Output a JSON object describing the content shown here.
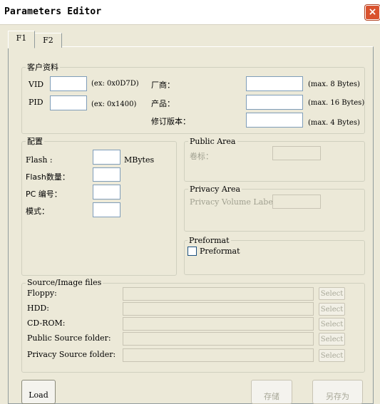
{
  "window": {
    "title": "Parameters Editor",
    "close_glyph": "×"
  },
  "tabs": [
    {
      "label": "F1"
    },
    {
      "label": "F2"
    }
  ],
  "customer": {
    "title": "客户资料",
    "vid_label": "VID",
    "vid_value": "",
    "vid_hint": "(ex: 0x0D7D)",
    "pid_label": "PID",
    "pid_value": "",
    "pid_hint": "(ex: 0x1400)",
    "vendor_label": "厂商：",
    "vendor_value": "",
    "vendor_hint": "(max. 8 Bytes)",
    "product_label": "产品：",
    "product_value": "",
    "product_hint": "(max. 16 Bytes)",
    "revision_label": "修订版本：",
    "revision_value": "",
    "revision_hint": "(max. 4 Bytes)"
  },
  "config": {
    "title": "配置",
    "flash_label": "Flash :",
    "flash_unit": "MBytes",
    "flash_count_label": "Flash数量：",
    "pc_label": "PC 编号：",
    "mode_label": "模式："
  },
  "public_area": {
    "title": "Public Area",
    "volume_label": "卷标："
  },
  "privacy_area": {
    "title": "Privacy Area",
    "volume_label": "Privacy Volume Label:"
  },
  "preformat": {
    "title": "Preformat",
    "checkbox_label": "Preformat",
    "checked": false
  },
  "source_files": {
    "title": "Source/Image files",
    "select_label": "Select",
    "rows": [
      {
        "label": "Floppy:"
      },
      {
        "label": "HDD:"
      },
      {
        "label": "CD-ROM:"
      },
      {
        "label": "Public Source folder:"
      },
      {
        "label": "Privacy Source folder:"
      }
    ]
  },
  "buttons": {
    "load": "Load",
    "save": "存储",
    "save_as": "另存为"
  }
}
